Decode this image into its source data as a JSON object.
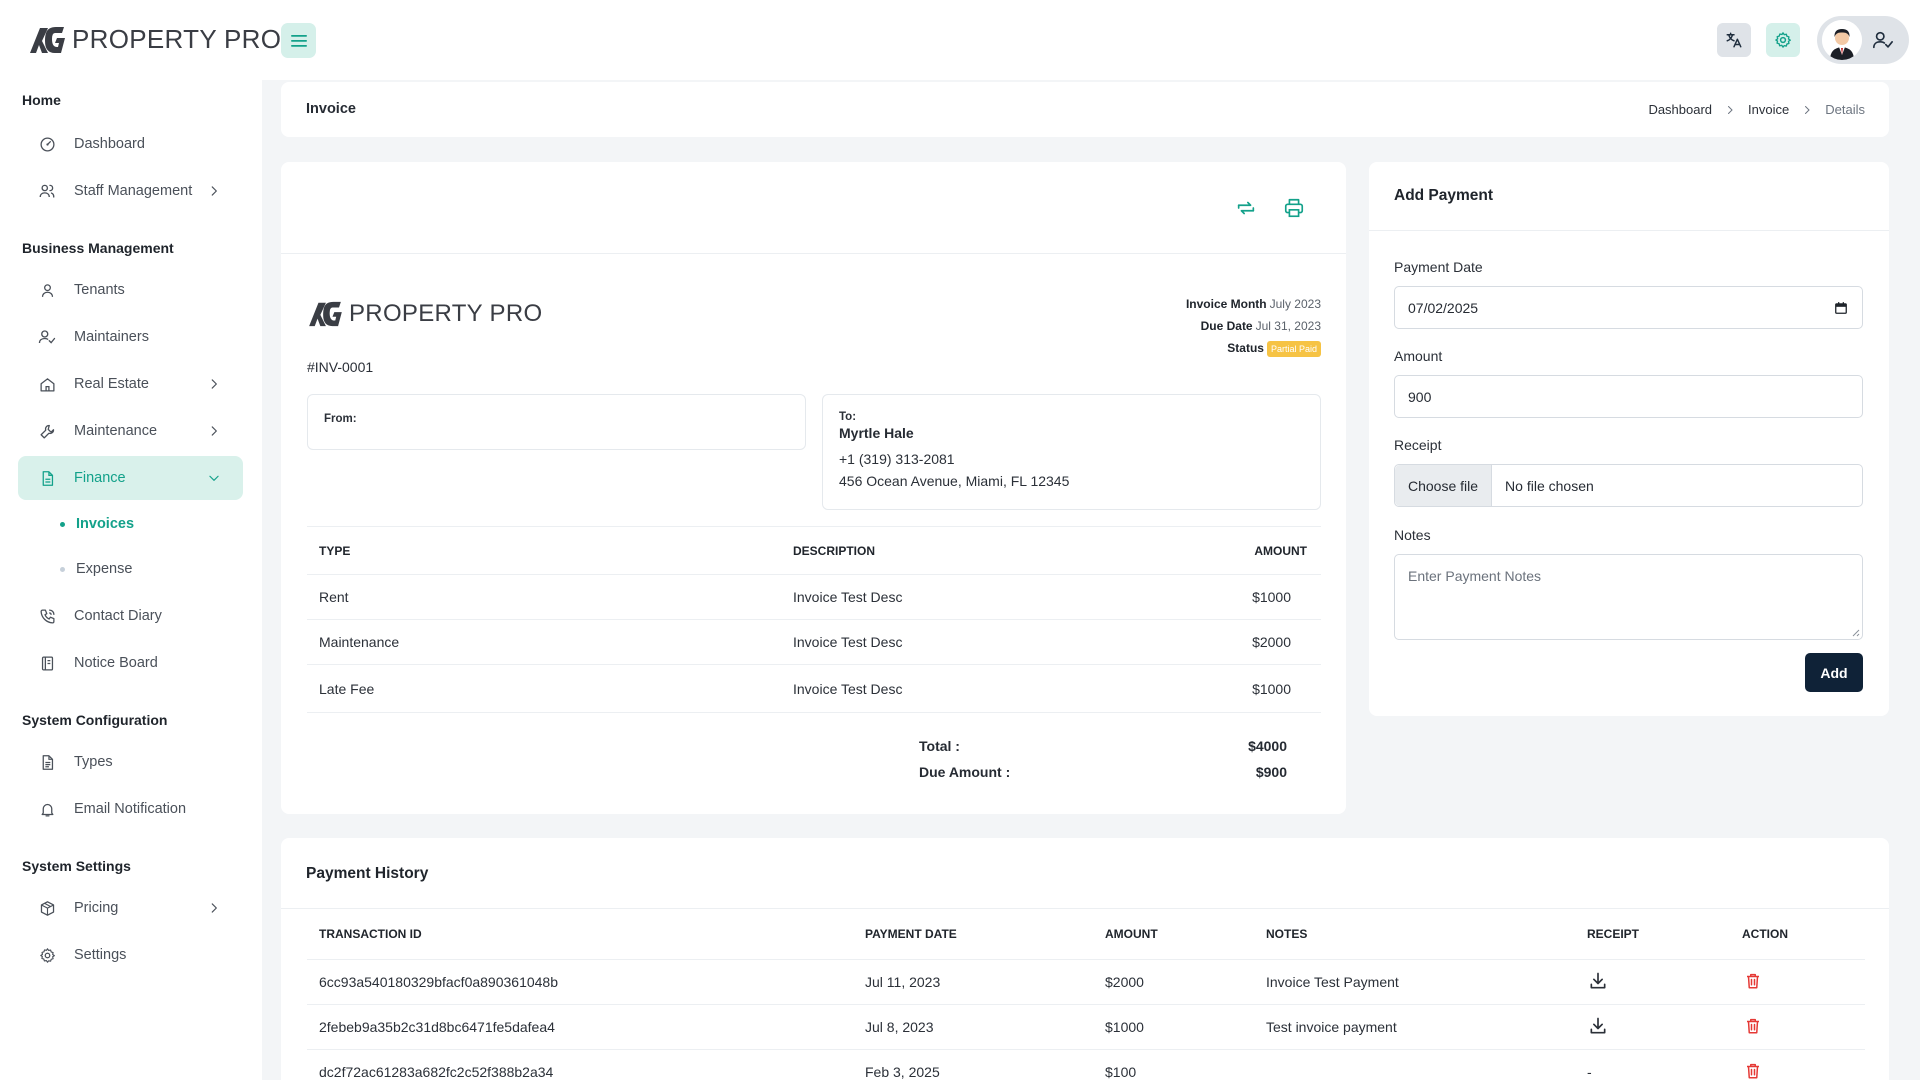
{
  "app": {
    "brand": "PROPERTY PRO"
  },
  "topbar": {
    "menu_icon": "hamburger-icon",
    "translate_icon": "translate-icon",
    "settings_icon": "gear-icon",
    "user_icon": "user-check-icon"
  },
  "sidebar": {
    "sections": {
      "home": "Home",
      "business": "Business Management",
      "system_config": "System Configuration",
      "system_settings": "System Settings"
    },
    "items": {
      "dashboard": "Dashboard",
      "staff": "Staff Management",
      "tenants": "Tenants",
      "maintainers": "Maintainers",
      "real_estate": "Real Estate",
      "maintenance": "Maintenance",
      "finance": "Finance",
      "invoices": "Invoices",
      "expense": "Expense",
      "contact_diary": "Contact Diary",
      "notice_board": "Notice Board",
      "types": "Types",
      "email_notification": "Email Notification",
      "pricing": "Pricing",
      "settings": "Settings"
    }
  },
  "header": {
    "title": "Invoice",
    "breadcrumb": [
      "Dashboard",
      "Invoice",
      "Details"
    ]
  },
  "invoice": {
    "number": "#INV-0001",
    "month_label": "Invoice Month",
    "month_value": "July 2023",
    "due_label": "Due Date",
    "due_value": "Jul 31, 2023",
    "status_label": "Status",
    "status_value": "Partial Paid",
    "from_label": "From:",
    "to_label": "To:",
    "to_name": "Myrtle Hale",
    "to_phone": "+1 (319) 313-2081",
    "to_address": "456 Ocean Avenue, Miami, FL 12345",
    "columns": [
      "TYPE",
      "DESCRIPTION",
      "AMOUNT"
    ],
    "rows": [
      {
        "type": "Rent",
        "description": "Invoice Test Desc",
        "amount": "$1000"
      },
      {
        "type": "Maintenance",
        "description": "Invoice Test Desc",
        "amount": "$2000"
      },
      {
        "type": "Late Fee",
        "description": "Invoice Test Desc",
        "amount": "$1000"
      }
    ],
    "total_label": "Total :",
    "total_value": "$4000",
    "due_amount_label": "Due Amount :",
    "due_amount_value": "$900"
  },
  "payment_form": {
    "title": "Add Payment",
    "date_label": "Payment Date",
    "date_value": "07/02/2025",
    "amount_label": "Amount",
    "amount_value": "900",
    "receipt_label": "Receipt",
    "choose_file": "Choose file",
    "no_file": "No file chosen",
    "notes_label": "Notes",
    "notes_placeholder": "Enter Payment Notes",
    "submit": "Add"
  },
  "payment_history": {
    "title": "Payment History",
    "columns": [
      "TRANSACTION ID",
      "PAYMENT DATE",
      "AMOUNT",
      "NOTES",
      "RECEIPT",
      "ACTION"
    ],
    "rows": [
      {
        "id": "6cc93a540180329bfacf0a890361048b",
        "date": "Jul 11, 2023",
        "amount": "$2000",
        "notes": "Invoice Test Payment",
        "receipt": "download-icon"
      },
      {
        "id": "2febeb9a35b2c31d8bc6471fe5dafea4",
        "date": "Jul 8, 2023",
        "amount": "$1000",
        "notes": "Test invoice payment",
        "receipt": "download-icon"
      },
      {
        "id": "dc2f72ac61283a682fc2c52f388b2a34",
        "date": "Feb 3, 2025",
        "amount": "$100",
        "notes": "",
        "receipt": "-"
      }
    ]
  },
  "colors": {
    "accent": "#13a18a",
    "accent_bg": "#d9f1eb",
    "primary_button": "#0f2237",
    "status_partial": "#f6c344",
    "delete": "#e53935"
  }
}
